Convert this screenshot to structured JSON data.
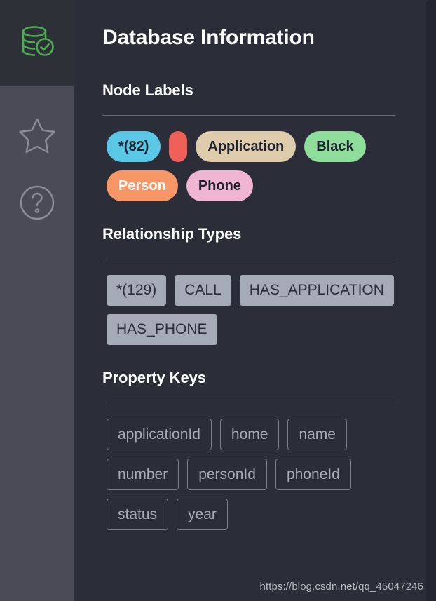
{
  "page": {
    "title": "Database Information",
    "background_color": "#2b2d38",
    "watermark": "https://blog.csdn.net/qq_45047246"
  },
  "rail": {
    "logo": {
      "icon": "database-check-icon",
      "color": "#4caf50"
    },
    "items": [
      {
        "icon": "star-icon",
        "label": "Favorites"
      },
      {
        "icon": "question-circle-icon",
        "label": "Help"
      }
    ]
  },
  "sections": [
    {
      "id": "node-labels",
      "title": "Node Labels",
      "chip_style": "pill",
      "chips": [
        {
          "label": "*(82)",
          "bg": "#5ac8e4",
          "fg": "#1d2330"
        },
        {
          "label": "",
          "bg": "#ef6059",
          "fg": "#1d2330"
        },
        {
          "label": "Application",
          "bg": "#decbac",
          "fg": "#1d2330"
        },
        {
          "label": "Black",
          "bg": "#8edd9b",
          "fg": "#1d2330"
        },
        {
          "label": "Person",
          "bg": "#f79767",
          "fg": "#ffffff"
        },
        {
          "label": "Phone",
          "bg": "#efb5d3",
          "fg": "#1d2330"
        }
      ]
    },
    {
      "id": "relationship-types",
      "title": "Relationship Types",
      "chip_style": "relchip",
      "chips": [
        {
          "label": "*(129)"
        },
        {
          "label": "CALL"
        },
        {
          "label": "HAS_APPLICATION"
        },
        {
          "label": "HAS_PHONE"
        }
      ]
    },
    {
      "id": "property-keys",
      "title": "Property Keys",
      "chip_style": "propchip",
      "chips": [
        {
          "label": "applicationId"
        },
        {
          "label": "home"
        },
        {
          "label": "name"
        },
        {
          "label": "number"
        },
        {
          "label": "personId"
        },
        {
          "label": "phoneId"
        },
        {
          "label": "status"
        },
        {
          "label": "year"
        }
      ]
    }
  ]
}
